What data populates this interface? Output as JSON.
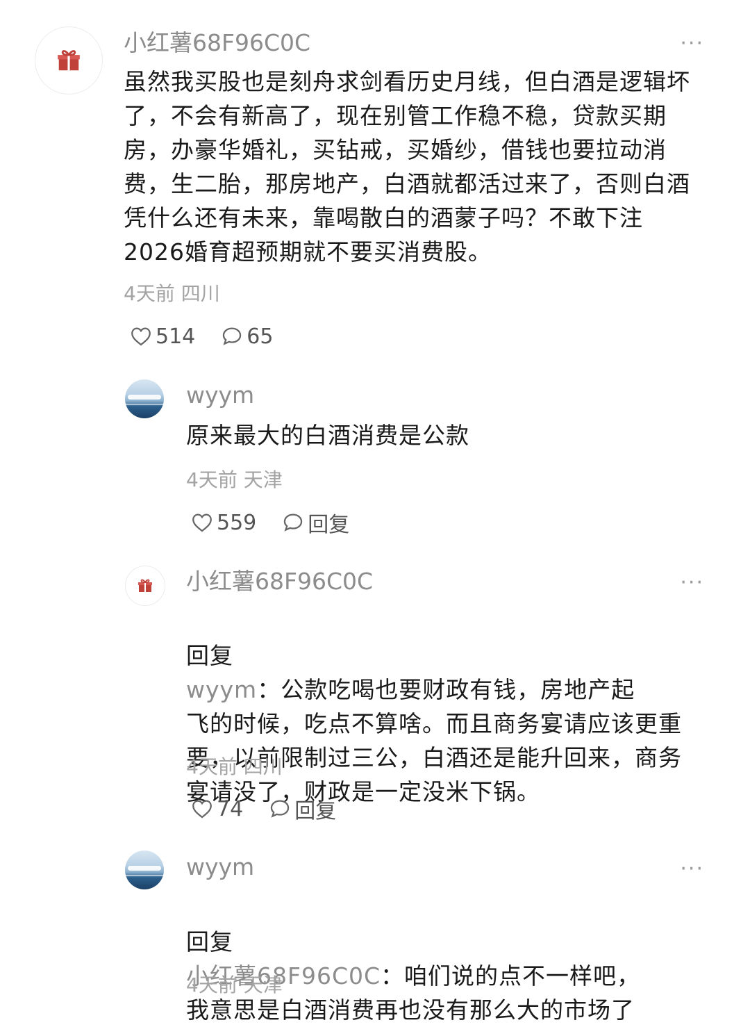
{
  "comments": [
    {
      "username": "小红薯68F96C0C",
      "more": "···",
      "text": "虽然我买股也是刻舟求剑看历史月线，但白酒是逻辑坏\n了，不会有新高了，现在别管工作稳不稳，贷款买期\n房，办豪华婚礼，买钻戒，买婚纱，借钱也要拉动消\n费，生二胎，那房地产，白酒就都活过来了，否则白酒\n凭什么还有未来，靠喝散白的酒蒙子吗？不敢下注\n2026婚育超预期就不要买消费股。",
      "time": "4天前",
      "location": "四川",
      "likes": "514",
      "replies": "65",
      "avatar_icon": "gift-icon"
    },
    {
      "username": "wyym",
      "text": "原来最大的白酒消费是公款",
      "time": "4天前",
      "location": "天津",
      "likes": "559",
      "reply_label": "回复",
      "avatar_icon": "sky-sea-avatar"
    },
    {
      "username": "小红薯68F96C0C",
      "more": "···",
      "reply_prefix": "回复",
      "reply_target": "wyym",
      "reply_colon": "：",
      "text": "公款吃喝也要财政有钱，房地产起\n飞的时候，吃点不算啥。而且商务宴请应该更重\n要，以前限制过三公，白酒还是能升回来，商务\n宴请没了，财政是一定没米下锅。",
      "time": "4天前",
      "location": "四川",
      "likes": "74",
      "reply_label": "回复",
      "avatar_icon": "gift-icon"
    },
    {
      "username": "wyym",
      "more": "···",
      "reply_prefix": "回复",
      "reply_target": "小红薯68F96C0C",
      "reply_colon": "：",
      "text": "咱们说的点不一样吧，\n我意思是白酒消费再也没有那么大的市场了",
      "time": "4天前",
      "location": "天津",
      "avatar_icon": "sky-sea-avatar"
    }
  ],
  "colors": {
    "name": "#8c8c8c",
    "text": "#1a1a1a",
    "meta": "#a3a3a3",
    "gift_red": "#c0403a"
  }
}
